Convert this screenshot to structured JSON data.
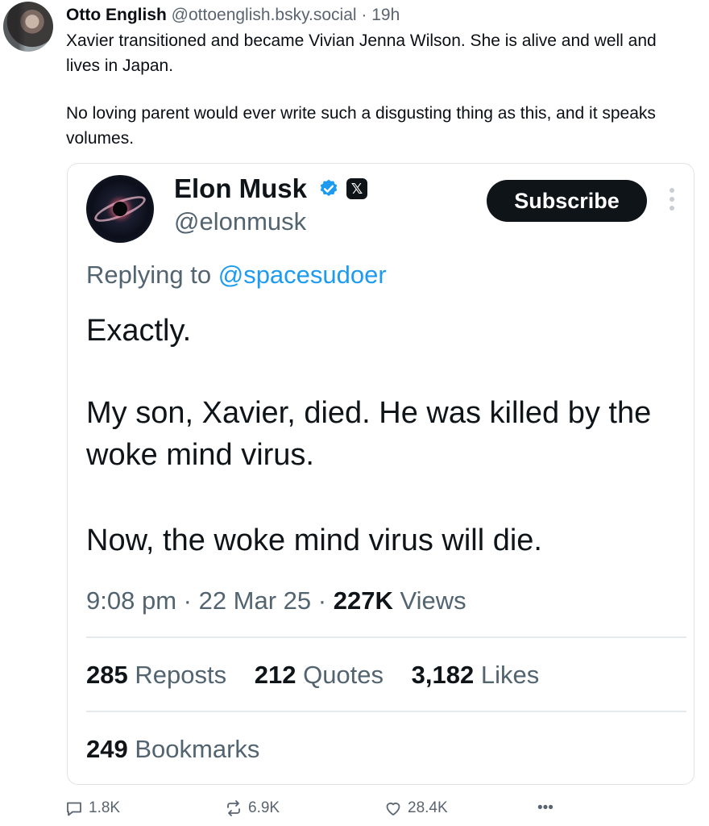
{
  "post": {
    "author_name": "Otto English",
    "author_handle": "@ottoenglish.bsky.social",
    "separator": "·",
    "time": "19h",
    "paragraph1": "Xavier transitioned and became Vivian Jenna Wilson. She is alive and well and lives in Japan.",
    "paragraph2": "No loving parent would ever write such a disgusting thing as this, and it speaks volumes."
  },
  "embed": {
    "name": "Elon Musk",
    "handle": "@elonmusk",
    "subscribe_label": "Subscribe",
    "x_badge": "𝕏",
    "replying_prefix": "Replying to",
    "replying_handle": "@spacesudoer",
    "text_line1": "Exactly.",
    "text_line2": "My son, Xavier, died. He was killed by the woke mind virus.",
    "text_line3": "Now, the woke mind virus will die.",
    "time": "9:08 pm",
    "date": "22 Mar 25",
    "views_count": "227K",
    "views_label": "Views",
    "reposts_count": "285",
    "reposts_label": "Reposts",
    "quotes_count": "212",
    "quotes_label": "Quotes",
    "likes_count": "3,182",
    "likes_label": "Likes",
    "bookmarks_count": "249",
    "bookmarks_label": "Bookmarks",
    "verified_color": "#1d9bf0"
  },
  "actions": {
    "replies": "1.8K",
    "reposts": "6.9K",
    "likes": "28.4K",
    "more": "•••"
  },
  "icons": [
    "reply-icon",
    "repost-icon",
    "like-icon",
    "more-icon",
    "verified-icon",
    "kebab-icon"
  ]
}
